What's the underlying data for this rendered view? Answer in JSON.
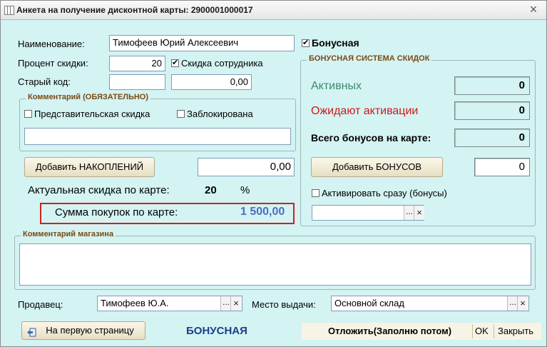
{
  "window": {
    "title": "Анкета на получение дисконтной карты: 2900001000017",
    "close": "×"
  },
  "name": {
    "label": "Наименование:",
    "value": "Тимофеев Юрий Алексеевич"
  },
  "bonus_checkbox": {
    "label": "Бонусная",
    "checked": true
  },
  "discount": {
    "label": "Процент скидки:",
    "value": "20"
  },
  "employee_discount": {
    "label": "Скидка сотрудника",
    "checked": true
  },
  "old_code": {
    "label": "Старый код:",
    "value1": "",
    "value2": "0,00"
  },
  "comment_group": {
    "title": "Комментарий (ОБЯЗАТЕЛЬНО)",
    "representative": {
      "label": "Представительская скидка",
      "checked": false
    },
    "blocked": {
      "label": "Заблокирована",
      "checked": false
    },
    "value": ""
  },
  "accumulations": {
    "button": "Добавить НАКОПЛЕНИЙ",
    "value": "0,00"
  },
  "actual_discount": {
    "label": "Актуальная скидка по карте:",
    "value": "20",
    "unit": "%"
  },
  "purchase_sum": {
    "label": "Сумма покупок по карте:",
    "value": "1 500,00"
  },
  "bonus_group": {
    "title": "БОНУСНАЯ СИСТЕМА СКИДОК",
    "active": {
      "label": "Активных",
      "value": "0",
      "color": "#3d8a6a"
    },
    "pending": {
      "label": "Ожидают активации",
      "value": "0",
      "color": "#d01818"
    },
    "total": {
      "label": "Всего бонусов на карте:",
      "value": "0"
    },
    "add_button": "Добавить БОНУСОВ",
    "add_value": "0",
    "activate_now": {
      "label": "Активировать сразу (бонусы)",
      "checked": false
    },
    "picker_value": ""
  },
  "shop_comment": {
    "title": "Комментарий магазина",
    "value": ""
  },
  "seller": {
    "label": "Продавец:",
    "value": "Тимофеев Ю.А."
  },
  "issue_place": {
    "label": "Место выдачи:",
    "value": "Основной склад"
  },
  "footer": {
    "first_page_button": "На первую страницу",
    "card_type": "БОНУСНАЯ",
    "postpone": "Отложить(Заполню потом)",
    "ok": "OK",
    "close": "Закрыть"
  },
  "colors": {
    "background": "#d4f3f3",
    "highlight_border": "#d02020",
    "sum_value": "#4a6fc0",
    "card_type": "#1a3f8a",
    "group_title": "#7a4a14"
  }
}
